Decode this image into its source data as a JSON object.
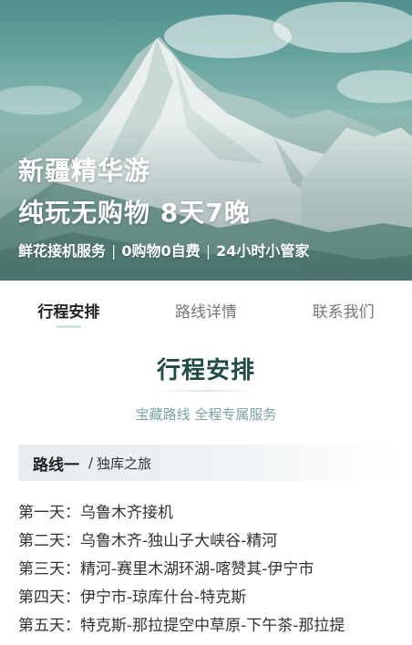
{
  "hero": {
    "title_line1": "新疆精华游",
    "title_line2": "纯玩无购物 8天7晚",
    "features": [
      "鲜花接机服务",
      "0购物0自费",
      "24小时小管家"
    ],
    "separator": "|"
  },
  "tabs": [
    {
      "label": "行程安排",
      "active": true
    },
    {
      "label": "路线详情",
      "active": false
    },
    {
      "label": "联系我们",
      "active": false
    }
  ],
  "section": {
    "title": "行程安排",
    "subtitle": "宝藏路线 全程专属服务"
  },
  "route": {
    "name": "路线一",
    "slash": "/",
    "desc": "独库之旅"
  },
  "days": [
    "第一天：乌鲁木齐接机",
    "第二天：乌鲁木齐-独山子大峡谷-精河",
    "第三天：精河-赛里木湖环湖-喀赞其-伊宁市",
    "第四天：伊宁市-琼库什台-特克斯",
    "第五天：特克斯-那拉提空中草原-下午茶-那拉提"
  ],
  "colors": {
    "accent": "#1f4a48",
    "subtitle": "#7aa3a0",
    "tab_underline": "#cfe3df"
  }
}
